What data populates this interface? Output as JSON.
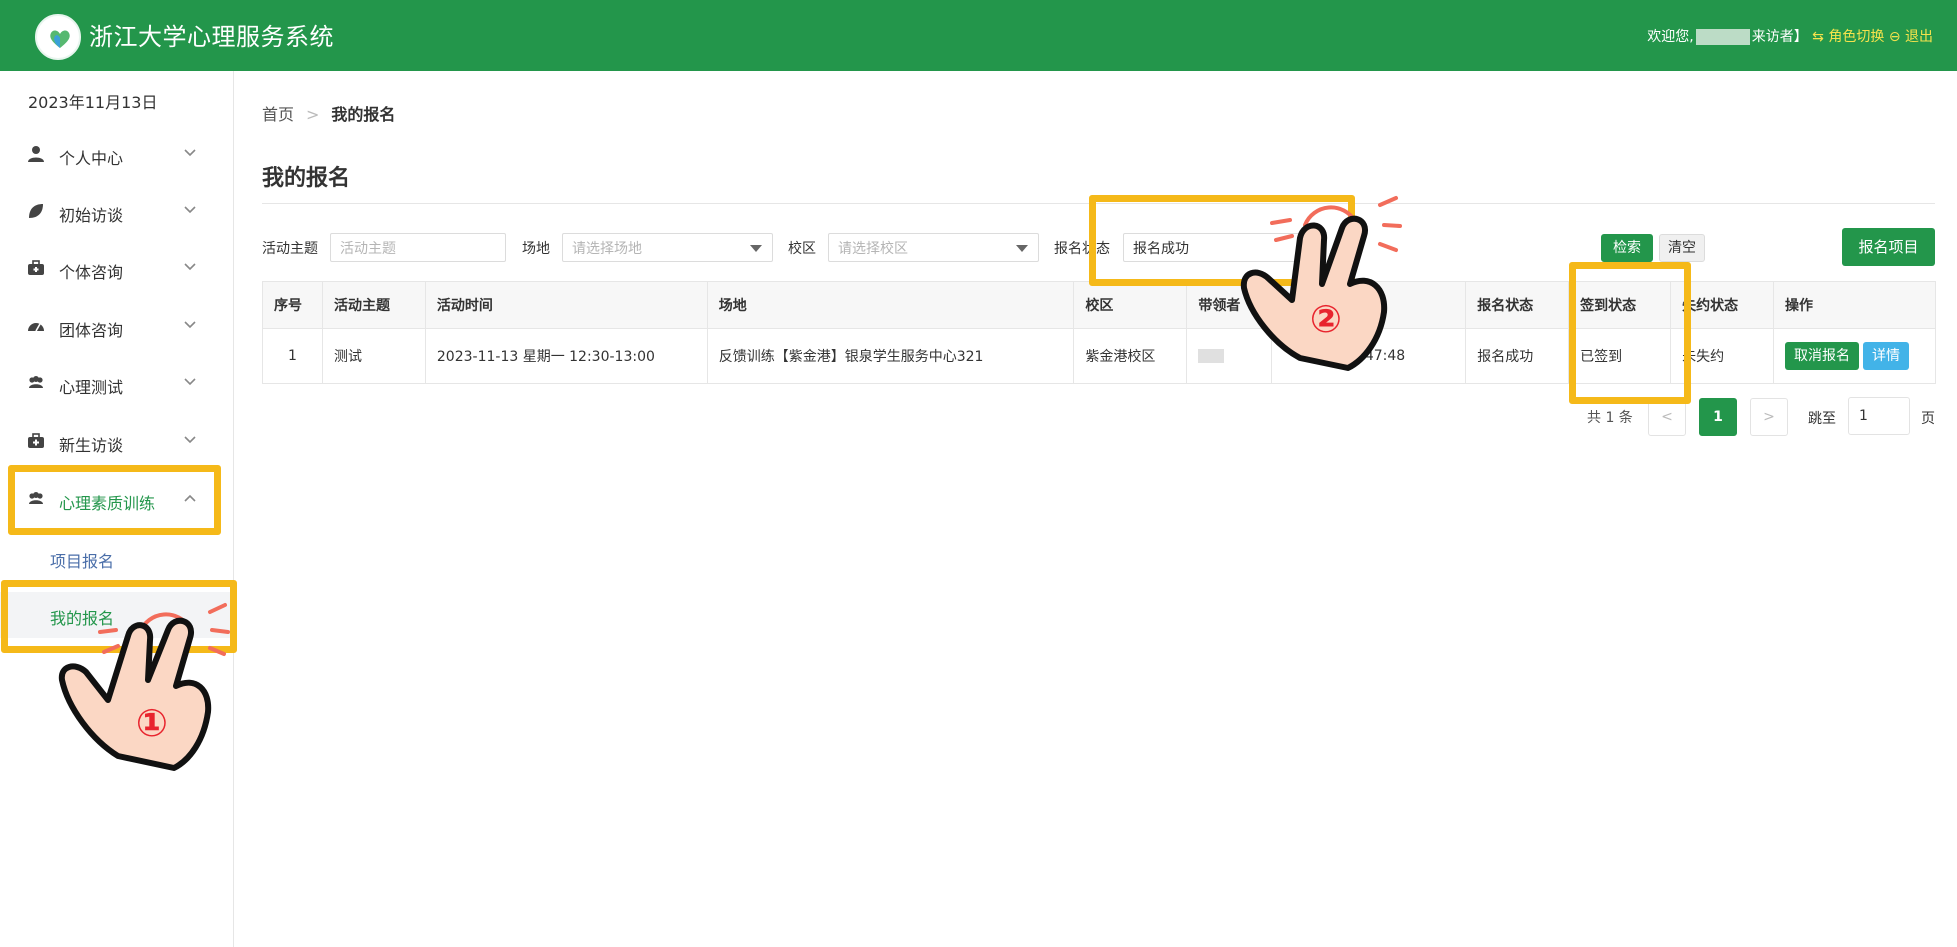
{
  "header": {
    "title": "浙江大学心理服务系统",
    "welcome_prefix": "欢迎您,",
    "welcome_suffix": "来访者】",
    "switch_role": "⇆ 角色切换",
    "logout": "⊖ 退出"
  },
  "sidebar": {
    "date": "2023年11月13日",
    "items": [
      {
        "label": "个人中心",
        "icon": "user-icon"
      },
      {
        "label": "初始访谈",
        "icon": "leaf-icon"
      },
      {
        "label": "个体咨询",
        "icon": "briefcase-icon"
      },
      {
        "label": "团体咨询",
        "icon": "gauge-icon"
      },
      {
        "label": "心理测试",
        "icon": "group-icon"
      },
      {
        "label": "新生访谈",
        "icon": "medkit-icon"
      },
      {
        "label": "心理素质训练",
        "icon": "group-icon"
      }
    ],
    "subitems": [
      {
        "label": "项目报名"
      },
      {
        "label": "我的报名"
      }
    ]
  },
  "breadcrumb": {
    "home": "首页",
    "sep": ">",
    "current": "我的报名"
  },
  "page_title": "我的报名",
  "filters": {
    "topic_label": "活动主题",
    "topic_placeholder": "活动主题",
    "venue_label": "场地",
    "venue_placeholder": "请选择场地",
    "campus_label": "校区",
    "campus_placeholder": "请选择校区",
    "status_label": "报名状态",
    "status_value": "报名成功",
    "search_btn": "检索",
    "clear_btn": "清空",
    "signup_btn": "报名项目"
  },
  "table": {
    "headers": [
      "序号",
      "活动主题",
      "活动时间",
      "场地",
      "校区",
      "带领者",
      "报名时间",
      "报名状态",
      "签到状态",
      "失约状态",
      "操作"
    ],
    "rows": [
      {
        "index": "1",
        "topic": "测试",
        "time": "2023-11-13 星期一 12:30-13:00",
        "venue": "反馈训练【紫金港】银泉学生服务中心321",
        "campus": "紫金港校区",
        "signup_time": "11:47:48",
        "status": "报名成功",
        "checkin": "已签到",
        "noshow": "未失约",
        "cancel_btn": "取消报名",
        "detail_btn": "详情"
      }
    ]
  },
  "pagination": {
    "total": "共 1 条",
    "prev": "<",
    "current": "1",
    "next": ">",
    "jump_label": "跳至",
    "jump_value": "1",
    "page_suffix": "页"
  },
  "annotations": {
    "step1": "①",
    "step2": "②"
  },
  "colors": {
    "brand": "#23964b",
    "highlight": "#f5b919",
    "detail": "#42b3e8"
  }
}
